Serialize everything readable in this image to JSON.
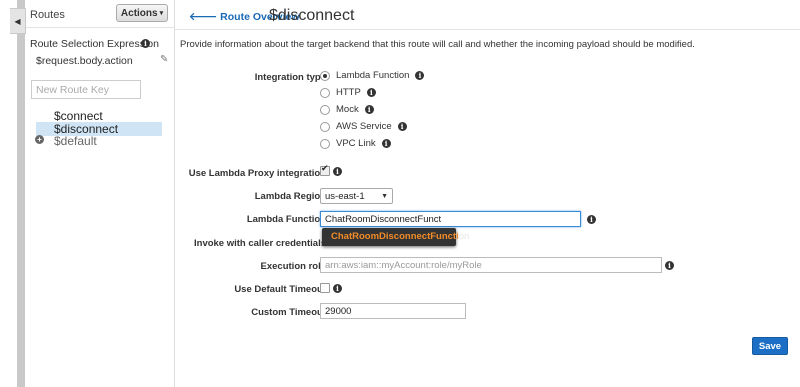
{
  "sidebar": {
    "heading": "Routes",
    "actions_label": "Actions",
    "route_selection_label": "Route Selection Expression",
    "route_selection_value": "$request.body.action",
    "new_route_placeholder": "New Route Key",
    "routes": [
      "$connect",
      "$disconnect",
      "$default"
    ],
    "selected_route": "$disconnect"
  },
  "header": {
    "back_label": "Route Overview",
    "title": "$disconnect"
  },
  "main": {
    "description": "Provide information about the target backend that this route will call and whether the incoming payload should be modified.",
    "integration_type_label": "Integration type",
    "integration_options": [
      "Lambda Function",
      "HTTP",
      "Mock",
      "AWS Service",
      "VPC Link"
    ],
    "integration_selected": "Lambda Function",
    "proxy_label": "Use Lambda Proxy integration",
    "proxy_checked": true,
    "region_label": "Lambda Region",
    "region_value": "us-east-1",
    "function_label": "Lambda Function",
    "function_value": "ChatRoomDisconnectFunct",
    "autocomplete_match": "ChatRoomDisconnectFuncti",
    "autocomplete_rest": "on",
    "caller_credentials_label": "Invoke with caller credentials",
    "execution_role_label": "Execution role",
    "execution_role_placeholder": "arn:aws:iam::myAccount:role/myRole",
    "default_timeout_label": "Use Default Timeout",
    "default_timeout_checked": false,
    "custom_timeout_label": "Custom Timeout",
    "custom_timeout_value": "29000",
    "save_label": "Save"
  },
  "icons": {
    "info": "info-icon",
    "back": "arrow-left-icon",
    "edit": "pencil-icon",
    "add": "plus-icon",
    "collapse": "caret-left-icon"
  },
  "colors": {
    "link": "#1a69b5",
    "save_button": "#1c6fc4",
    "selection": "#cfe5f5",
    "autocomplete_highlight": "#f28c28"
  }
}
